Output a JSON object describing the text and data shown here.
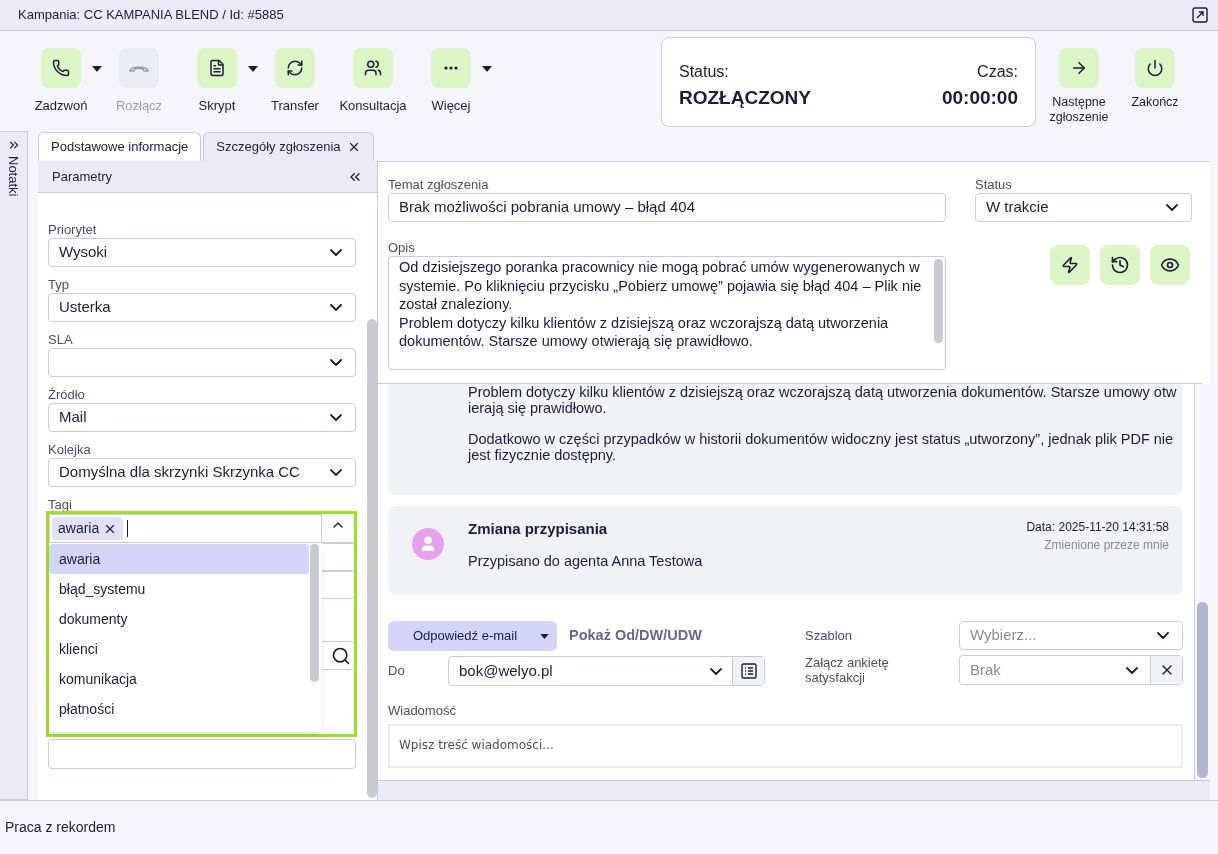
{
  "window": {
    "title": "Kampania: CC KAMPANIA BLEND / Id: #5885"
  },
  "toolbar": [
    {
      "label": "Zadzwoń",
      "disabled": false,
      "menu": true
    },
    {
      "label": "Rozłącz",
      "disabled": true,
      "menu": false
    },
    {
      "label": "Skrypt",
      "disabled": false,
      "menu": true
    },
    {
      "label": "Transfer",
      "disabled": false,
      "menu": false
    },
    {
      "label": "Konsultacja",
      "disabled": false,
      "menu": false
    },
    {
      "label": "Więcej",
      "disabled": false,
      "menu": true
    }
  ],
  "status_panel": {
    "status_label": "Status:",
    "status": "ROZŁĄCZONY",
    "time_label": "Czas:",
    "time": "00:00:00"
  },
  "actions": [
    {
      "label": "Następne zgłoszenie"
    },
    {
      "label": "Zakończ"
    }
  ],
  "notes_tab": {
    "label": "Notatki"
  },
  "tabs": [
    {
      "label": "Podstawowe informacje",
      "selected": true,
      "closable": false
    },
    {
      "label": "Szczegóły zgłoszenia",
      "selected": false,
      "closable": true
    }
  ],
  "parameters": {
    "title": "Parametry",
    "fields": [
      {
        "label": "Priorytet",
        "value": "Wysoki"
      },
      {
        "label": "Typ",
        "value": "Usterka"
      },
      {
        "label": "SLA"
      },
      {
        "label": "Źródło",
        "value": "Mail"
      },
      {
        "label": "Kolejka",
        "value": "Domyślna dla skrzynki Skrzynka CC"
      }
    ],
    "tags": {
      "label": "Tagi",
      "chips": [
        "awaria"
      ],
      "expanded": true,
      "options": [
        {
          "label": "awaria",
          "selected": true
        },
        {
          "label": "błąd_systemu",
          "selected": false
        },
        {
          "label": "dokumenty",
          "selected": false
        },
        {
          "label": "klienci",
          "selected": false
        },
        {
          "label": "komunikacja",
          "selected": false
        },
        {
          "label": "płatności",
          "selected": false
        }
      ]
    }
  },
  "ticket": {
    "subject_label": "Temat zgłoszenia",
    "subject": "Brak możliwości pobrania umowy – błąd 404",
    "status_label": "Status",
    "status": "W trakcie",
    "description_label": "Opis",
    "description": [
      "Od dzisiejszego poranka pracownicy nie mogą pobrać umów wygenerowanych w systemie. Po kliknięciu przycisku „Pobierz umowę” pojawia się błąd 404 – Plik nie został znaleziony.",
      "Problem dotyczy kilku klientów z dzisiejszą oraz wczorajszą datą utworzenia dokumentów. Starsze umowy otwierają się prawidłowo."
    ]
  },
  "feed": [
    {
      "kind": "message",
      "paragraphs": [
        "Problem dotyczy kilku klientów z dzisiejszą oraz wczorajszą datą utworzenia dokumentów. Starsze umowy otwierają się prawidłowo.",
        "Dodatkowo w części przypadków w historii dokumentów widoczny jest status „utworzony”, jednak plik PDF nie jest fizycznie dostępny."
      ]
    },
    {
      "kind": "event",
      "title": "Zmiana przypisania",
      "text": "Przypisano do agenta Anna Testowa",
      "date": "Data: 2025-11-20 14:31:58",
      "author": "Zmienione przeze mnie"
    }
  ],
  "reply": {
    "mode": "Odpowiedź e-mail",
    "toggle_fields": "Pokaż Od/DW/UDW",
    "to_label": "Do",
    "to": "bok@welyo.pl",
    "template_label": "Szablon",
    "template_placeholder": "Wybierz...",
    "survey_label": "Załącz ankietę satysfakcji",
    "survey": "Brak",
    "message_label": "Wiadomość",
    "message_placeholder": "Wpisz treść wiadomości..."
  },
  "status_bar": {
    "text": "Praca z rekordem"
  }
}
